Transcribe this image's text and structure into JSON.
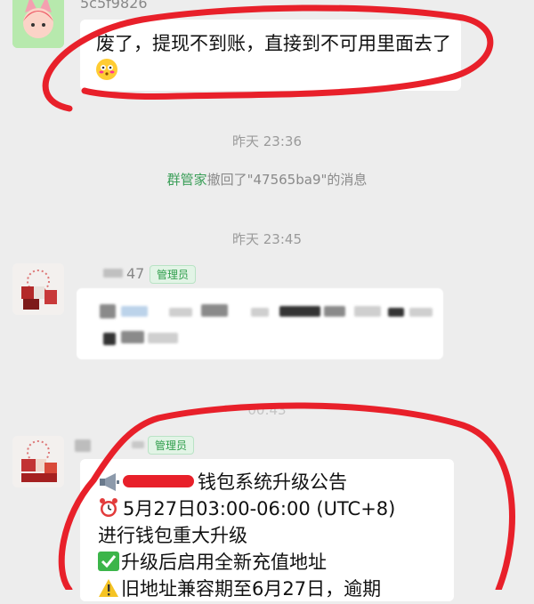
{
  "messages": {
    "m1": {
      "sender_name": "5c5f9826",
      "text": "废了，提现不到账，直接到不可用里面去了",
      "emoji": "😳"
    },
    "time1": "昨天 23:36",
    "recall": {
      "actor": "群管家",
      "text": "撤回了\"47565ba9\"的消息"
    },
    "time2": "昨天 23:45",
    "m2": {
      "sender_name_visible": "47",
      "badge": "管理员"
    },
    "time3": "00:43",
    "m3": {
      "badge": "管理员",
      "lines": [
        "钱包系统升级公告",
        "5月27日03:00-06:00 (UTC+8)",
        "进行钱包重大升级",
        "升级后启用全新充值地址",
        "旧地址兼容期至6月27日，逾期"
      ],
      "icons": [
        "megaphone-icon",
        "alarm-clock-icon",
        "check-mark-icon",
        "warning-icon"
      ]
    }
  },
  "colors": {
    "background": "#ededed",
    "bubble": "#ffffff",
    "annotation_red": "#e8202a",
    "admin_green": "#2f9e4b",
    "system_link_green": "#3a9e58"
  }
}
